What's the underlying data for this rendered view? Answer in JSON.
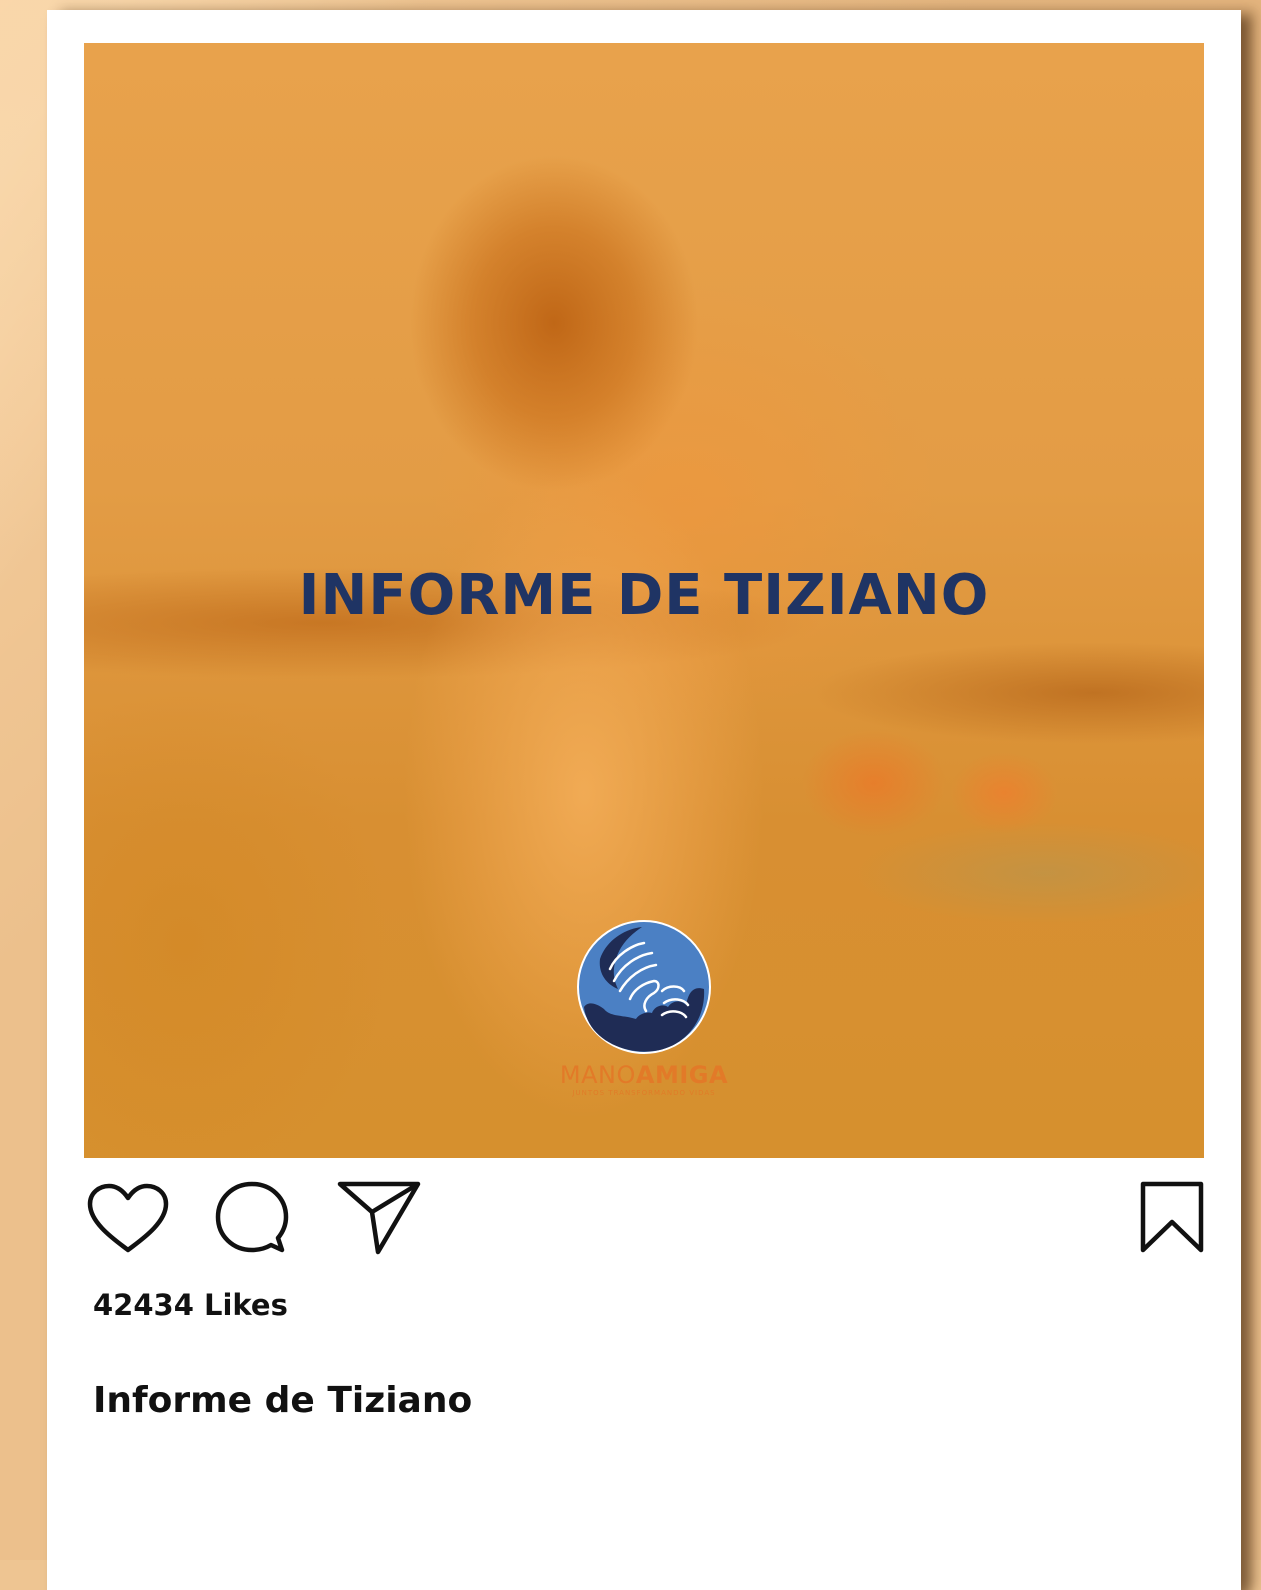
{
  "post": {
    "image_title": "INFORME DE TIZIANO",
    "logo": {
      "name_part1": "MANO",
      "name_part2": "AMIGA",
      "tagline": "JUNTOS TRANSFORMANDO VIDAS",
      "circle_color": "#4b80c4",
      "hand_color": "#1f2c55",
      "text_color": "#e27a28"
    },
    "likes_text": "42434 Likes",
    "caption": "Informe de Tiziano"
  },
  "actions": {
    "like_icon": "heart-icon",
    "comment_icon": "speech-bubble-icon",
    "share_icon": "paper-plane-icon",
    "save_icon": "bookmark-icon"
  },
  "colors": {
    "title_color": "#1f3464",
    "page_background": "#ecc08c",
    "card_background": "#ffffff",
    "text_color": "#111111"
  }
}
